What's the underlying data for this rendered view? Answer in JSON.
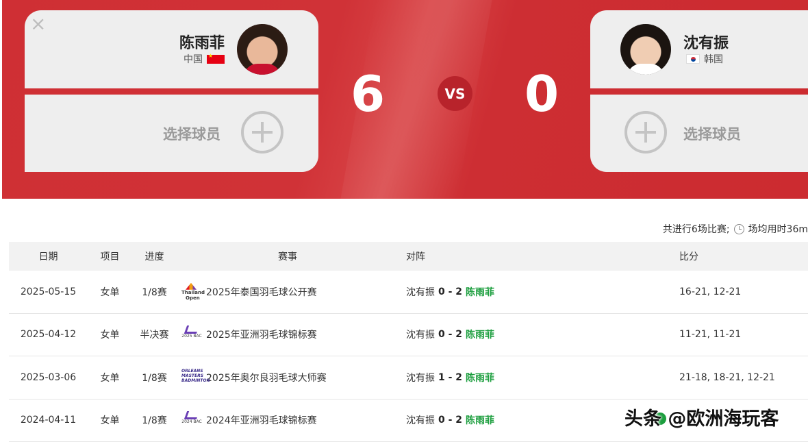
{
  "header": {
    "close_glyph": "×",
    "left_player": {
      "name": "陈雨菲",
      "country": "中国",
      "flag": "china-flag-icon"
    },
    "right_player": {
      "name": "沈有振",
      "country": "韩国",
      "flag": "korea-flag-icon"
    },
    "left_slot2_label": "选择球员",
    "right_slot2_label": "选择球员",
    "left_score": "6",
    "right_score": "0",
    "vs_label": "VS"
  },
  "summary": {
    "matches_text": "共进行6场比赛;",
    "avg_time_text": "场均用时36m"
  },
  "table": {
    "headers": {
      "date": "日期",
      "event": "项目",
      "stage": "进度",
      "tournament": "赛事",
      "matchup": "对阵",
      "score": "比分"
    },
    "rows": [
      {
        "date": "2025-05-15",
        "event": "女单",
        "stage": "1/8赛",
        "tournament": "2025年泰国羽毛球公开赛",
        "logo": "thailand-open-logo",
        "logo_text": [
          "Thailand",
          "Open"
        ],
        "left": "沈有振",
        "score": "0 - 2",
        "winner": "陈雨菲",
        "games": "16-21, 12-21"
      },
      {
        "date": "2025-04-12",
        "event": "女单",
        "stage": "半决赛",
        "tournament": "2025年亚洲羽毛球锦标赛",
        "logo": "bac-2025-logo",
        "logo_text": [
          "2025 BAC"
        ],
        "left": "沈有振",
        "score": "0 - 2",
        "winner": "陈雨菲",
        "games": "11-21, 11-21"
      },
      {
        "date": "2025-03-06",
        "event": "女单",
        "stage": "1/8赛",
        "tournament": "2025年奥尔良羽毛球大师赛",
        "logo": "orleans-masters-logo",
        "logo_text": [
          "ORLEANS",
          "MASTERS",
          "BADMINTON"
        ],
        "left": "沈有振",
        "score": "1 - 2",
        "winner": "陈雨菲",
        "games": "21-18, 18-21, 12-21"
      },
      {
        "date": "2024-04-11",
        "event": "女单",
        "stage": "1/8赛",
        "tournament": "2024年亚洲羽毛球锦标赛",
        "logo": "bac-2024-logo",
        "logo_text": [
          "2024 BAC"
        ],
        "left": "沈有振",
        "score": "0 - 2",
        "winner": "陈雨菲",
        "games": ""
      }
    ]
  },
  "watermark": "头条 @欧洲海玩客",
  "colors": {
    "hero_red": "#d03237",
    "winner_green": "#1c9e3e",
    "vs_badge": "#b8232b"
  }
}
